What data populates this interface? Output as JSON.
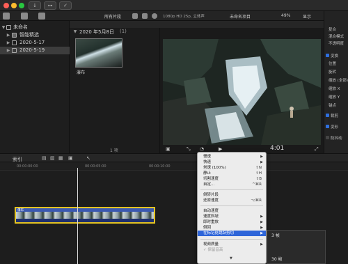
{
  "library": {
    "root": "未命名",
    "items": [
      {
        "label": "智能精选"
      },
      {
        "label": "2020-5-17"
      },
      {
        "label": "2020-5-19"
      }
    ]
  },
  "browser": {
    "filter": "所有片段",
    "date_group": "2020 年5月8日",
    "date_count": "(1)",
    "clip_name": "瀑布",
    "footer": "1 项"
  },
  "viewer": {
    "format": "1080p HD 25p, 立体声",
    "project": "未命名项目",
    "zoom": "49%",
    "display": "显示",
    "timecode": "4:01"
  },
  "inspector": {
    "rows": [
      "复合",
      "混合模式",
      "不透明度",
      "变换",
      "位置",
      "旋转",
      "缩放 (全部)",
      "缩放 X",
      "缩放 Y",
      "锚点",
      "裁剪",
      "变形",
      "防抖动"
    ]
  },
  "timeline": {
    "index_label": "索引",
    "ruler": [
      "00:00:00:00",
      "00:00:05:00",
      "00:00:10:00"
    ],
    "clip_label": "瀑布"
  },
  "context_menu": {
    "items": [
      {
        "label": "慢速",
        "shortcut": "",
        "arrow": "▶"
      },
      {
        "label": "快速",
        "shortcut": "",
        "arrow": "▶"
      },
      {
        "label": "常速 (100%)",
        "shortcut": "⇧N",
        "arrow": ""
      },
      {
        "label": "静止",
        "shortcut": "⇧H",
        "arrow": ""
      },
      {
        "label": "切割速度",
        "shortcut": "⇧B",
        "arrow": ""
      },
      {
        "label": "自定...",
        "shortcut": "^⌘R",
        "arrow": ""
      },
      {
        "label": "倒转片段",
        "shortcut": "",
        "arrow": ""
      },
      {
        "label": "还原速度",
        "shortcut": "⌥⌘R",
        "arrow": ""
      },
      {
        "label": "自动速度",
        "shortcut": "",
        "arrow": ""
      },
      {
        "label": "速度斜坡",
        "shortcut": "",
        "arrow": "▶"
      },
      {
        "label": "即时重放",
        "shortcut": "",
        "arrow": "▶"
      },
      {
        "label": "倒回",
        "shortcut": "",
        "arrow": "▶"
      },
      {
        "label": "在标记处跳跃剪切",
        "shortcut": "",
        "arrow": "▶"
      },
      {
        "label": "视频质量",
        "shortcut": "",
        "arrow": "▶"
      },
      {
        "label": "✓ 保留音高",
        "shortcut": "",
        "arrow": ""
      }
    ],
    "bottom_arrow": "▼"
  },
  "submenu": {
    "items": [
      "3 帧",
      "30 帧"
    ]
  },
  "colors": {
    "accent": "#2e65d9",
    "clip_border": "#e3c322",
    "clip_fill": "#3a58b0"
  }
}
